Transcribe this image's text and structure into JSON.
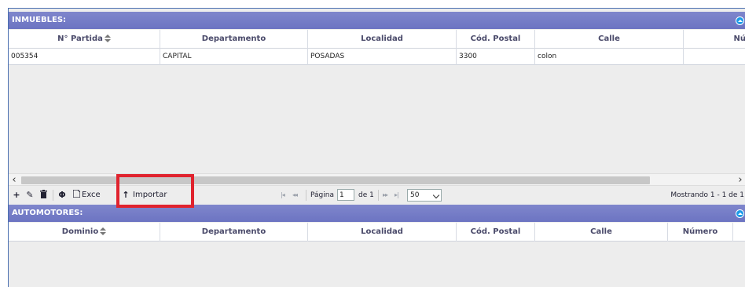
{
  "inmuebles": {
    "title": "INMUEBLES:",
    "columns": [
      "N° Partida",
      "Departamento",
      "Localidad",
      "Cód. Postal",
      "Calle",
      "Nú"
    ],
    "rows": [
      [
        "005354",
        "CAPITAL",
        "POSADAS",
        "3300",
        "colon",
        ""
      ]
    ],
    "scroll": {
      "left_icon": "chevron-left-icon",
      "right_icon": "chevron-right-icon"
    }
  },
  "toolbar": {
    "add_icon": "+",
    "edit_icon": "✎",
    "delete_icon": "🗑",
    "refresh_icon": "Φ",
    "excel_label": "Exce",
    "import_label": "Importar",
    "import_icon": "↑"
  },
  "pager": {
    "first": "|◂",
    "prev": "◂◂",
    "page_label": "Página",
    "page_value": "1",
    "of_label": "de 1",
    "next": "▸▸",
    "last": "▸|",
    "rows_per_page": "50",
    "status": "Mostrando 1 - 1 de 1"
  },
  "automotores": {
    "title": "AUTOMOTORES:",
    "columns": [
      "Dominio",
      "Departamento",
      "Localidad",
      "Cód. Postal",
      "Calle",
      "Número"
    ]
  },
  "colors": {
    "header": "#6c74c2",
    "highlight": "#e0232e",
    "collapse": "#1e9be8"
  }
}
